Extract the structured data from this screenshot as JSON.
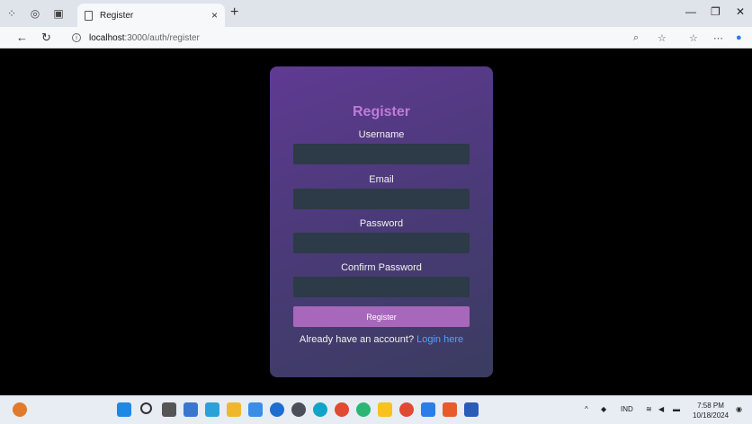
{
  "browser": {
    "tab_title": "Register",
    "url_host": "localhost",
    "url_path": ":3000/auth/register"
  },
  "form": {
    "heading": "Register",
    "username_label": "Username",
    "email_label": "Email",
    "password_label": "Password",
    "confirm_password_label": "Confirm Password",
    "submit_label": "Register",
    "footer_text": "Already have an account?",
    "login_link": "Login here"
  },
  "taskbar": {
    "language": "IND",
    "time": "7:58 PM",
    "date": "10/18/2024"
  },
  "colors": {
    "heading": "#c07bd6",
    "button": "#a768bb",
    "link": "#4da3ff",
    "input_bg": "#2d3a48"
  }
}
